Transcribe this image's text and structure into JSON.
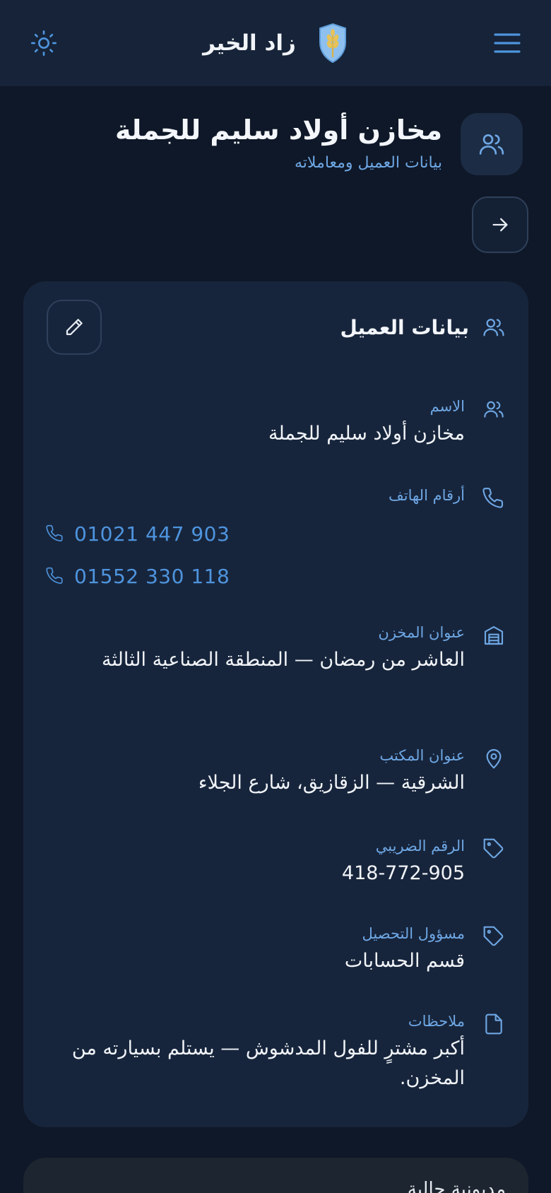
{
  "header": {
    "brand_name": "زاد الخير",
    "icons": [
      "menu-icon",
      "shield-wheat-logo",
      "sun-icon"
    ]
  },
  "page": {
    "title": "مخازن أولاد سليم للجملة",
    "subtitle": "بيانات العميل ومعاملاته"
  },
  "card": {
    "title": "بيانات العميل",
    "fields": {
      "name": {
        "label": "الاسم",
        "value": "مخازن أولاد سليم للجملة"
      },
      "phones": {
        "label": "أرقام الهاتف",
        "values": [
          "01021 447 903",
          "01552 330 118"
        ]
      },
      "warehouse": {
        "label": "عنوان المخزن",
        "value": "العاشر من رمضان — المنطقة الصناعية الثالثة"
      },
      "office": {
        "label": "عنوان المكتب",
        "value": "الشرقية — الزقازيق، شارع الجلاء"
      },
      "tax": {
        "label": "الرقم الضريبي",
        "value": "418-772-905"
      },
      "collector": {
        "label": "مسؤول التحصيل",
        "value": "قسم الحسابات"
      },
      "notes": {
        "label": "ملاحظات",
        "value": "أكبر مشترٍ للفول المدشوش — يستلم بسيارته من المخزن."
      }
    }
  },
  "next_card": {
    "title": "مديونية حالية"
  },
  "colors": {
    "background": "#0f1828",
    "header": "#162338",
    "card": "#17253c",
    "accent": "#4e94de",
    "label": "#6ea7e4"
  }
}
